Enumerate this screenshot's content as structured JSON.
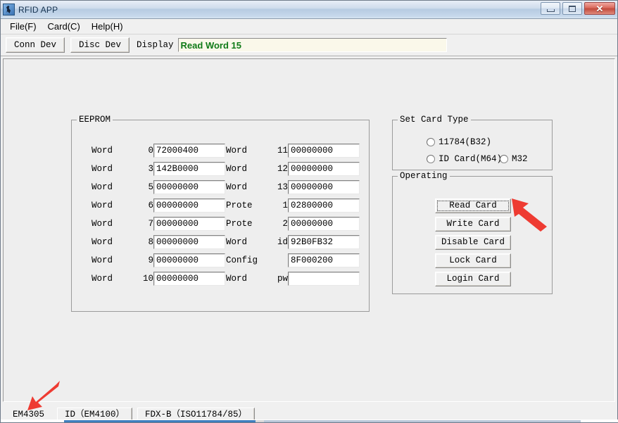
{
  "window": {
    "title": "RFID APP",
    "icon": "app-icon",
    "caption_buttons": [
      {
        "name": "minimize",
        "glyph": "minimize-icon"
      },
      {
        "name": "maximize",
        "glyph": "maximize-icon"
      },
      {
        "name": "close",
        "glyph": "✕"
      }
    ]
  },
  "menubar": {
    "items": [
      {
        "label": "File(F)"
      },
      {
        "label": "Card(C)"
      },
      {
        "label": "Help(H)"
      }
    ]
  },
  "toolbar": {
    "conn_dev_label": "Conn Dev",
    "disc_dev_label": "Disc Dev",
    "display_label": "Display",
    "display_value": "Read Word 15",
    "display_text_color": "#0f7a17",
    "display_bg_color": "#faf8ea"
  },
  "eeprom": {
    "title": "EEPROM",
    "left_column": [
      {
        "label_name": "Word",
        "label_index": "0",
        "value": "72000400"
      },
      {
        "label_name": "Word",
        "label_index": "3",
        "value": "142B0000"
      },
      {
        "label_name": "Word",
        "label_index": "5",
        "value": "00000000"
      },
      {
        "label_name": "Word",
        "label_index": "6",
        "value": "00000000"
      },
      {
        "label_name": "Word",
        "label_index": "7",
        "value": "00000000"
      },
      {
        "label_name": "Word",
        "label_index": "8",
        "value": "00000000"
      },
      {
        "label_name": "Word",
        "label_index": "9",
        "value": "00000000"
      },
      {
        "label_name": "Word",
        "label_index": "10",
        "value": "00000000"
      }
    ],
    "right_column": [
      {
        "label_name": "Word",
        "label_index": "11",
        "value": "00000000"
      },
      {
        "label_name": "Word",
        "label_index": "12",
        "value": "00000000"
      },
      {
        "label_name": "Word",
        "label_index": "13",
        "value": "00000000"
      },
      {
        "label_name": "Prote",
        "label_index": "1",
        "value": "02800000"
      },
      {
        "label_name": "Prote",
        "label_index": "2",
        "value": "00000000"
      },
      {
        "label_name": "Word",
        "label_index": "id",
        "value": "92B0FB32"
      },
      {
        "label_name": "Config",
        "label_index": "",
        "value": "8F000200"
      },
      {
        "label_name": "Word",
        "label_index": "pw",
        "value": ""
      }
    ]
  },
  "card_type": {
    "title": "Set Card Type",
    "options": [
      {
        "label": "11784(B32)",
        "checked": false
      },
      {
        "label": "ID Card(M64)",
        "checked": false
      },
      {
        "label": "M32",
        "checked": false
      }
    ]
  },
  "operating": {
    "title": "Operating",
    "buttons": [
      {
        "label": "Read Card",
        "focused": true
      },
      {
        "label": "Write Card",
        "focused": false
      },
      {
        "label": "Disable Card",
        "focused": false
      },
      {
        "label": "Lock Card",
        "focused": false
      },
      {
        "label": "Login Card",
        "focused": false
      }
    ]
  },
  "statusbar": {
    "tabs": [
      {
        "label": "EM4305",
        "selected": true
      },
      {
        "label": "ID（EM4100）",
        "selected": false
      },
      {
        "label": "FDX-B（ISO11784/85）",
        "selected": false
      }
    ]
  },
  "annotations": {
    "arrow_color": "#ee3b32",
    "arrows": [
      {
        "name": "arrow-pointing-read-card",
        "target": "Read Card"
      },
      {
        "name": "arrow-pointing-em4305-tab",
        "target": "EM4305"
      }
    ]
  }
}
